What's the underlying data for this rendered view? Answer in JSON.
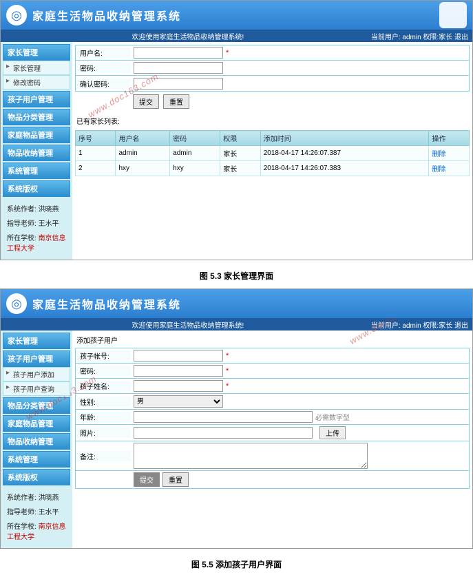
{
  "app": {
    "title": "家庭生活物品收纳管理系统",
    "welcome": "欢迎使用家庭生活物品收纳管理系统!",
    "user_prefix": "当前用户: ",
    "user": "admin",
    "role_prefix": "权限:",
    "role": "家长",
    "logout": "退出"
  },
  "sidebar": {
    "groups": [
      {
        "head": "家长管理",
        "items": [
          "家长管理",
          "修改密码"
        ]
      },
      {
        "head": "孩子用户管理",
        "items": []
      },
      {
        "head": "物品分类管理",
        "items": []
      },
      {
        "head": "家庭物品管理",
        "items": []
      },
      {
        "head": "物品收纳管理",
        "items": []
      },
      {
        "head": "系统管理",
        "items": []
      },
      {
        "head": "系统版权",
        "items": []
      }
    ],
    "info": {
      "author_label": "系统作者:",
      "author": "洪晓燕",
      "teacher_label": "指导老师:",
      "teacher": "王水平",
      "school_label": "所在学校:",
      "school": "南京信息工程大学"
    }
  },
  "sidebar2": {
    "groups": [
      {
        "head": "家长管理",
        "items": []
      },
      {
        "head": "孩子用户管理",
        "items": [
          "孩子用户添加",
          "孩子用户查询"
        ]
      },
      {
        "head": "物品分类管理",
        "items": []
      },
      {
        "head": "家庭物品管理",
        "items": []
      },
      {
        "head": "物品收纳管理",
        "items": []
      },
      {
        "head": "系统管理",
        "items": []
      },
      {
        "head": "系统版权",
        "items": []
      }
    ]
  },
  "form1": {
    "username_label": "用户名:",
    "password_label": "密码:",
    "confirm_label": "确认密码:",
    "submit": "提交",
    "reset": "重置",
    "list_title": "已有家长列表:"
  },
  "table1": {
    "headers": [
      "序号",
      "用户名",
      "密码",
      "权限",
      "添加时间",
      "操作"
    ],
    "rows": [
      {
        "username": "admin",
        "password": "admin",
        "role": "家长",
        "time": "2018-04-17 14:26:07.387",
        "op": "删除"
      },
      {
        "username": "hxy",
        "password": "hxy",
        "role": "家长",
        "time": "2018-04-17 14:26:07.383",
        "op": "删除"
      }
    ]
  },
  "caption1": "图 5.3 家长管理界面",
  "form2": {
    "panel_title": "添加孩子用户",
    "account_label": "孩子帐号:",
    "password_label": "密码:",
    "name_label": "孩子姓名:",
    "gender_label": "性别:",
    "gender_value": "男",
    "age_label": "年龄:",
    "age_hint": "必需数字型",
    "photo_label": "照片:",
    "upload": "上传",
    "note_label": "备注:",
    "submit": "提交",
    "reset": "重置"
  },
  "caption2": "图 5.5 添加孩子用户界面",
  "watermark": "www.doc163.com"
}
